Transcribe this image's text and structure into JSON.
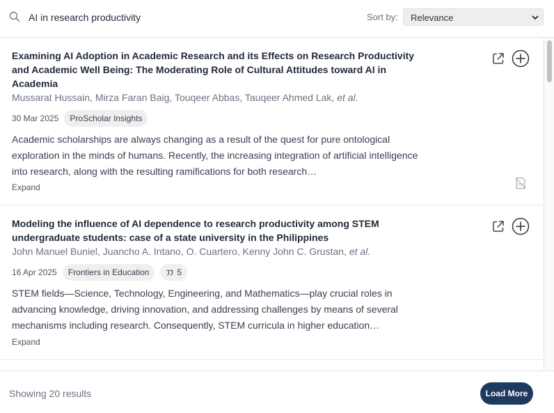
{
  "search": {
    "query": "AI in research productivity",
    "icon": "search-icon"
  },
  "sort": {
    "label": "Sort by:",
    "selected": "Relevance"
  },
  "results": [
    {
      "title": "Examining AI Adoption in Academic Research and its Effects on Research Productivity and Academic Well Being: The Moderating Role of Cultural Attitudes toward AI in Academia",
      "authors": "Mussarat Hussain, Mirza Faran Baig, Touqeer Abbas, Tauqeer Ahmed Lak,",
      "et_al": "et al.",
      "date": "30 Mar 2025",
      "venue": "ProScholar Insights",
      "abstract": "Academic scholarships are always changing as a result of the quest for pure ontological exploration in the minds of humans. Recently, the increasing integration of artificial intelligence into research, along with the resulting ramifications for both research…",
      "expand": "Expand"
    },
    {
      "title": "Modeling the influence of AI dependence to research productivity among STEM undergraduate students: case of a state university in the Philippines",
      "authors": "John Manuel Buniel, Juancho A. Intano, O. Cuartero, Kenny John C. Grustan,",
      "et_al": "et al.",
      "date": "16 Apr 2025",
      "venue": "Frontiers in Education",
      "citations": "5",
      "abstract": "STEM fields—Science, Technology, Engineering, and Mathematics—play crucial roles in advancing knowledge, driving innovation, and addressing challenges by means of several mechanisms including research. Consequently, STEM curricula in higher education…",
      "expand": "Expand"
    }
  ],
  "footer": {
    "showing": "Showing 20 results",
    "load_more": "Load More"
  },
  "colors": {
    "load_more_bg": "#1e3a5f",
    "tag_bg": "#efefef"
  }
}
